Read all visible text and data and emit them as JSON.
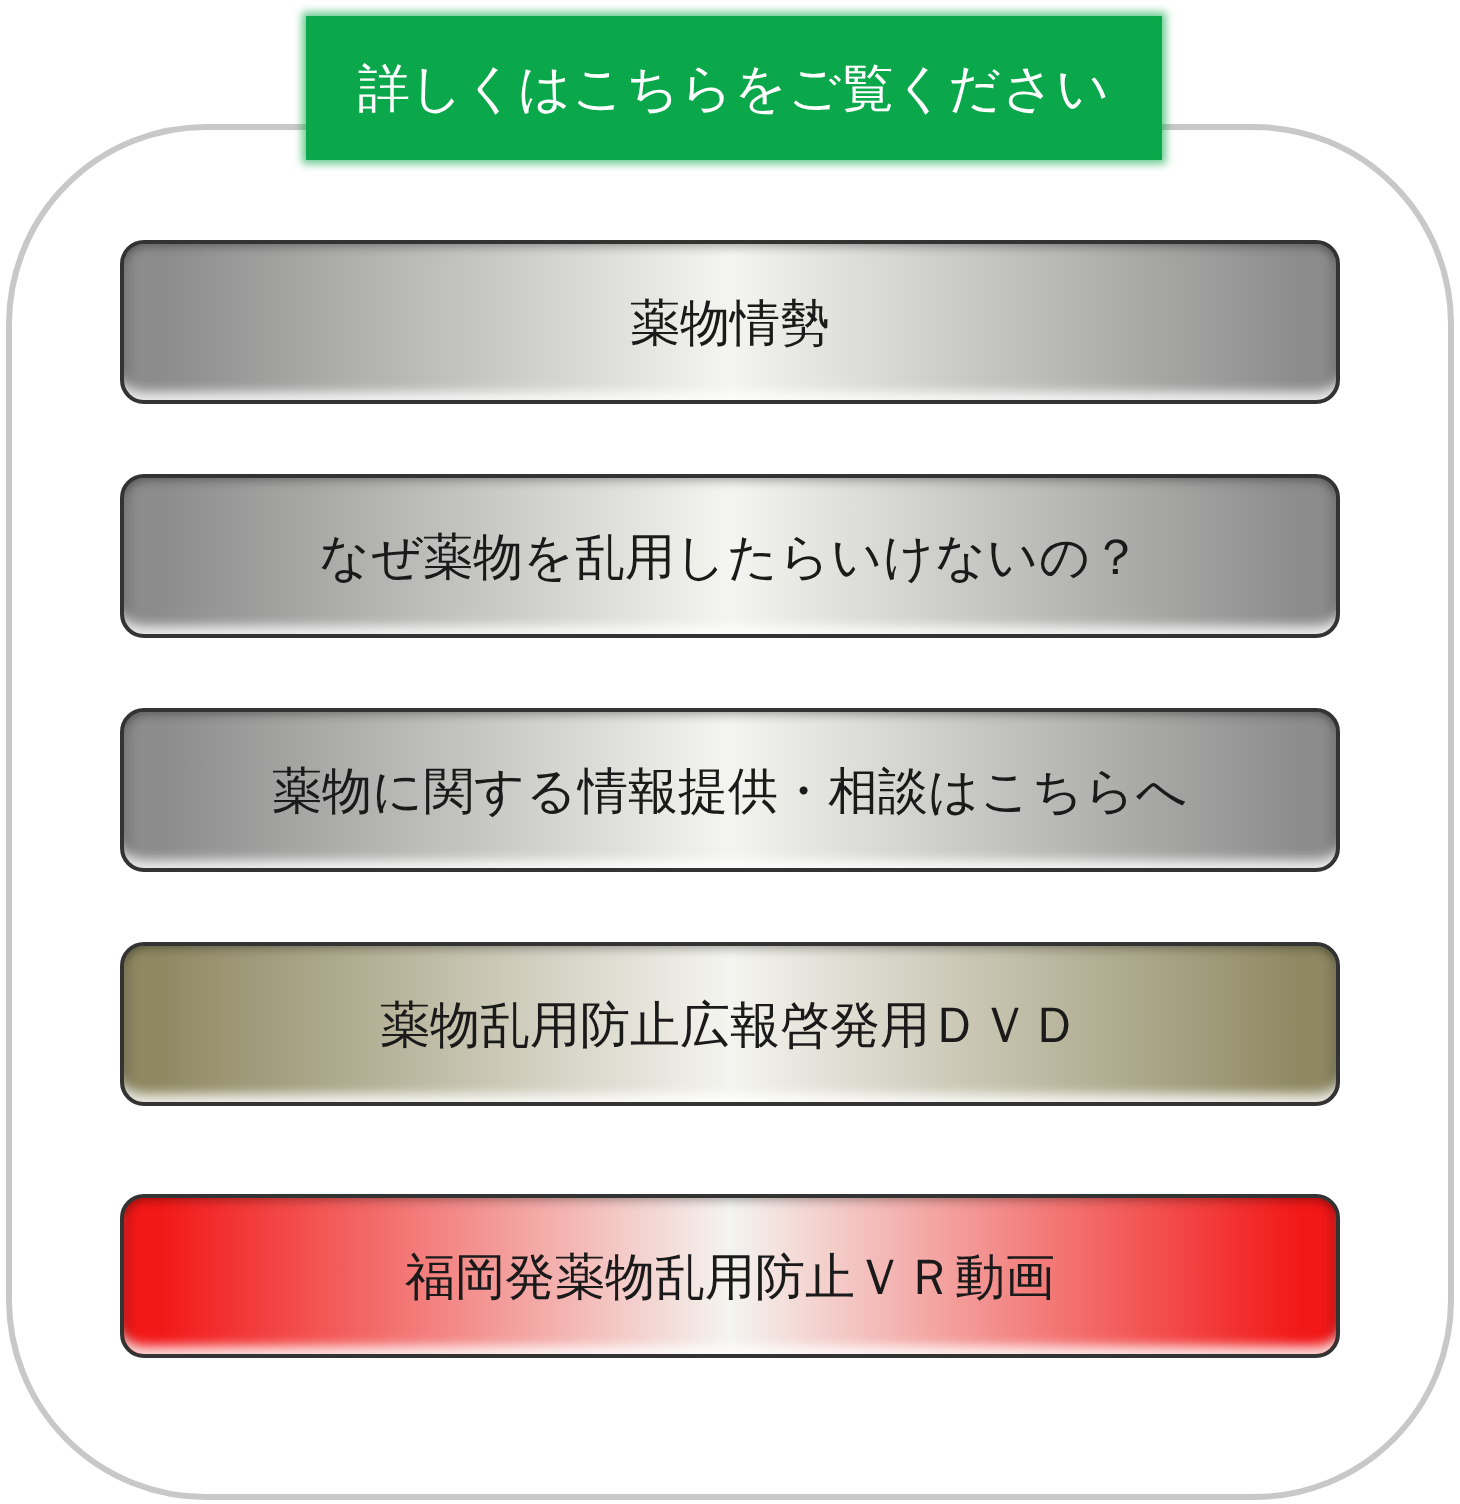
{
  "header": {
    "label": "詳しくはこちらをご覧ください"
  },
  "buttons": [
    {
      "label": "薬物情勢",
      "color": "#8c8c8c"
    },
    {
      "label": "なぜ薬物を乱用したらいけないの？",
      "color": "#8c8c8c"
    },
    {
      "label": "薬物に関する情報提供・相談はこちらへ",
      "color": "#8c8c8c"
    },
    {
      "label": "薬物乱用防止広報啓発用ＤＶＤ",
      "color": "#8f8962"
    },
    {
      "label": "福岡発薬物乱用防止ＶＲ動画",
      "color": "#f21818"
    }
  ]
}
